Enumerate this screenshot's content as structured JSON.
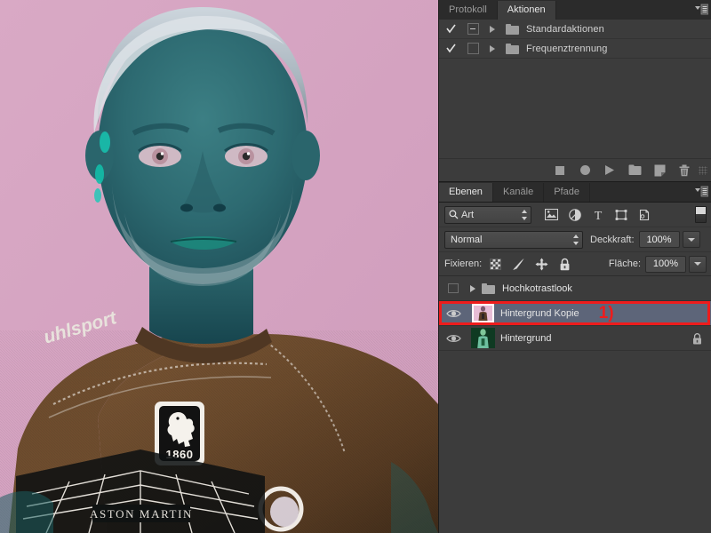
{
  "canvas": {
    "alt": "portrait-photo-inverted-colors",
    "background_color": "#d7a7c3",
    "skin_color": "#2f6e73",
    "hair_color": "#cfd6dc",
    "jersey_color": "#6b4a2c",
    "crest_text": "1860",
    "sponsor_text": "ASTON MARTIN",
    "brand_text": "uhlsport"
  },
  "actions_panel": {
    "tabs": [
      {
        "label": "Protokoll",
        "active": false
      },
      {
        "label": "Aktionen",
        "active": true
      }
    ],
    "menu_icon": "panel-menu-icon",
    "rows": [
      {
        "checked": "✓",
        "modal": "dash",
        "expanded": false,
        "name": "Standardaktionen",
        "icon": "folder-icon"
      },
      {
        "checked": "✓",
        "modal": "empty",
        "expanded": false,
        "name": "Frequenztrennung",
        "icon": "folder-icon"
      }
    ],
    "toolbar": [
      {
        "icon": "stop-icon",
        "title": "Stop"
      },
      {
        "icon": "record-icon",
        "title": "Aufzeichnen"
      },
      {
        "icon": "play-icon",
        "title": "Ausführen"
      },
      {
        "icon": "new-set-folder-icon",
        "title": "Neuer Satz"
      },
      {
        "icon": "new-action-page-icon",
        "title": "Neue Aktion"
      },
      {
        "icon": "trash-icon",
        "title": "Löschen"
      }
    ]
  },
  "layers_panel": {
    "tabs": [
      {
        "label": "Ebenen",
        "active": true
      },
      {
        "label": "Kanäle",
        "active": false
      },
      {
        "label": "Pfade",
        "active": false
      }
    ],
    "menu_icon": "panel-menu-icon",
    "filter": {
      "search_icon": "magnifier-icon",
      "value": "Art",
      "icons": [
        "pixel-layer-filter-icon",
        "adjustment-layer-filter-icon",
        "type-layer-filter-icon",
        "shape-layer-filter-icon",
        "smart-object-filter-icon"
      ],
      "toggle": "filter-on-off-switch"
    },
    "blend": {
      "mode": "Normal",
      "opacity_label": "Deckkraft:",
      "opacity_value": "100%"
    },
    "lock": {
      "label": "Fixieren:",
      "icons": [
        "lock-transparent-pixels-icon",
        "lock-image-pixels-icon",
        "lock-position-icon",
        "lock-all-icon"
      ],
      "fill_label": "Fläche:",
      "fill_value": "100%"
    },
    "layers": [
      {
        "type": "group",
        "name": "Hochkotrastlook",
        "visible": false,
        "selected": false,
        "locked": false,
        "annotated": false,
        "thumb_kind": "folder"
      },
      {
        "type": "layer",
        "name": "Hintergrund Kopie",
        "visible": true,
        "selected": true,
        "locked": false,
        "annotated": true,
        "annotation_label": "1)",
        "annotation_color": "#ee1c1c",
        "thumb_kind": "pink-portrait"
      },
      {
        "type": "layer",
        "name": "Hintergrund",
        "visible": true,
        "selected": false,
        "locked": true,
        "annotated": false,
        "thumb_kind": "green-portrait"
      }
    ]
  }
}
